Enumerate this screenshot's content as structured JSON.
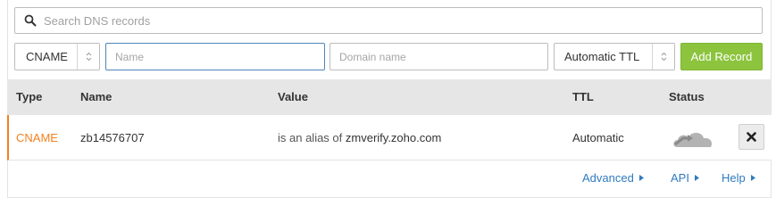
{
  "search": {
    "placeholder": "Search DNS records",
    "icon": "search-icon"
  },
  "form": {
    "type_value": "CNAME",
    "name_placeholder": "Name",
    "domain_placeholder": "Domain name",
    "ttl_value": "Automatic TTL",
    "add_label": "Add Record"
  },
  "table": {
    "headers": {
      "type": "Type",
      "name": "Name",
      "value": "Value",
      "ttl": "TTL",
      "status": "Status"
    },
    "rows": [
      {
        "type": "CNAME",
        "name": "zb14576707",
        "value_prefix": "is an alias of",
        "value": "zmverify.zoho.com",
        "ttl": "Automatic",
        "status_icon": "cloud-dns-only-icon",
        "delete_icon": "close-icon"
      }
    ]
  },
  "footer": {
    "advanced": "Advanced",
    "api": "API",
    "help": "Help"
  },
  "colors": {
    "accent": "#f38020",
    "add_button": "#8cc43e",
    "link": "#2f7bbf",
    "header_bg": "#e6e6e6"
  }
}
